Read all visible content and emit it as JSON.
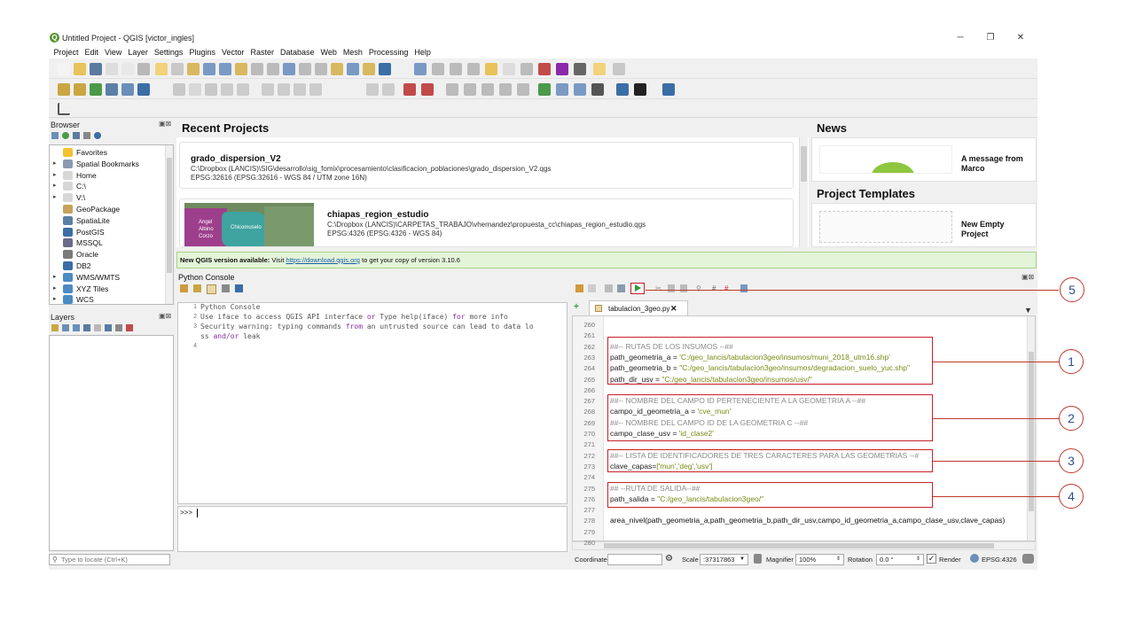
{
  "window": {
    "title": "Untitled Project - QGIS [victor_ingles]",
    "logo_letter": "Q",
    "minimize": "─",
    "restore": "❐",
    "close": "✕"
  },
  "menu": [
    "Project",
    "Edit",
    "View",
    "Layer",
    "Settings",
    "Plugins",
    "Vector",
    "Raster",
    "Database",
    "Web",
    "Mesh",
    "Processing",
    "Help"
  ],
  "browser": {
    "title": "Browser",
    "items": [
      {
        "label": "Favorites",
        "icon": "star-icon",
        "color": "#f2c230"
      },
      {
        "label": "Spatial Bookmarks",
        "icon": "bookmark-icon",
        "color": "#8a9bb0"
      },
      {
        "label": "Home",
        "icon": "home-folder-icon",
        "color": "#d7d7d7"
      },
      {
        "label": "C:\\",
        "icon": "drive-icon",
        "color": "#d7d7d7"
      },
      {
        "label": "V:\\",
        "icon": "drive-icon",
        "color": "#d7d7d7"
      },
      {
        "label": "GeoPackage",
        "icon": "geopackage-icon",
        "color": "#c6a35a"
      },
      {
        "label": "SpatiaLite",
        "icon": "spatialite-icon",
        "color": "#5c7fa6"
      },
      {
        "label": "PostGIS",
        "icon": "postgis-icon",
        "color": "#3a6ea5"
      },
      {
        "label": "MSSQL",
        "icon": "mssql-icon",
        "color": "#6a6a8a"
      },
      {
        "label": "Oracle",
        "icon": "oracle-icon",
        "color": "#7a7a7a"
      },
      {
        "label": "DB2",
        "icon": "db2-icon",
        "color": "#3a6ea5"
      },
      {
        "label": "WMS/WMTS",
        "icon": "globe-icon",
        "color": "#4a8bc4"
      },
      {
        "label": "XYZ Tiles",
        "icon": "globe-icon",
        "color": "#4a8bc4"
      },
      {
        "label": "WCS",
        "icon": "globe-icon",
        "color": "#4a8bc4"
      }
    ]
  },
  "layers": {
    "title": "Layers"
  },
  "locate": {
    "placeholder": "Type to locate (Ctrl+K)"
  },
  "recent": {
    "title": "Recent Projects",
    "projects": [
      {
        "name": "grado_dispersion_V2",
        "path": "C:\\Dropbox (LANCIS)\\SIG\\desarrollo\\sig_fomix\\procesamiento\\clasificacion_poblaciones\\grado_dispersion_V2.qgs",
        "crs": "EPSG:32616 (EPSG:32616 - WGS 84 / UTM zone 16N)"
      },
      {
        "name": "chiapas_region_estudio",
        "path": "C:\\Dropbox (LANCIS)\\CARPETAS_TRABAJO\\vhernandez\\propuesta_cc\\chiapas_region_estudio.qgs",
        "crs": "EPSG:4326 (EPSG:4326 - WGS 84)",
        "thumb_labels": [
          "Angel Albino Corzo",
          "Chicomuselo"
        ]
      }
    ]
  },
  "news": {
    "title": "News",
    "message_title": "A message from Marco"
  },
  "templates": {
    "title": "Project Templates",
    "item": "New Empty Project"
  },
  "banner": {
    "prefix": "New QGIS version available:",
    "visit": "Visit",
    "link": "https://download.qgis.org",
    "suffix": "to get your copy of version 3.10.6"
  },
  "python_console": {
    "title": "Python Console",
    "lines": [
      {
        "num": "1",
        "text": "Python Console"
      },
      {
        "num": "2",
        "text": "Use iface to access QGIS API interface or Type help(iface) for more info"
      },
      {
        "num": "3",
        "text": "Security warning: typing commands from an untrusted source can lead to data lo"
      },
      {
        "num": "",
        "text": "ss and/or leak"
      },
      {
        "num": "4",
        "text": ""
      }
    ],
    "prompt": ">>>"
  },
  "editor": {
    "tab": "tabulacion_3geo.py",
    "tab_close": "✕",
    "lines": [
      {
        "num": "260",
        "text": ""
      },
      {
        "num": "261",
        "text": ""
      },
      {
        "num": "262",
        "text": "##-- RUTAS DE LOS INSUMOS --##"
      },
      {
        "num": "263",
        "text": "path_geometria_a = 'C:/geo_lancis/tabulacion3geo/insumos/muni_2018_utm16.shp'"
      },
      {
        "num": "264",
        "text": "path_geometria_b = \"C:/geo_lancis/tabulacion3geo/insumos/degradacion_suelo_yuc.shp\""
      },
      {
        "num": "265",
        "text": "path_dir_usv = \"C:/geo_lancis/tabulacion3geo/insumos/usv/\""
      },
      {
        "num": "266",
        "text": ""
      },
      {
        "num": "267",
        "text": "##-- NOMBRE DEL CAMPO ID PERTENECIENTE A LA GEOMETRIA A --##"
      },
      {
        "num": "268",
        "text": "campo_id_geometria_a = 'cve_mun'"
      },
      {
        "num": "269",
        "text": "##-- NOMBRE DEL CAMPO ID DE LA GEOMETRIA C --##"
      },
      {
        "num": "270",
        "text": "campo_clase_usv = 'id_clase2'"
      },
      {
        "num": "271",
        "text": ""
      },
      {
        "num": "272",
        "text": "##-- LISTA DE IDENTIFICADORES DE TRES CARACTERES PARA LAS GEOMETRIAS --#"
      },
      {
        "num": "273",
        "text": "clave_capas=['mun','deg','usv']"
      },
      {
        "num": "274",
        "text": ""
      },
      {
        "num": "275",
        "text": "## --RUTA DE SALIDA--##"
      },
      {
        "num": "276",
        "text": "path_salida = \"C:/geo_lancis/tabulacion3geo/\""
      },
      {
        "num": "277",
        "text": ""
      },
      {
        "num": "278",
        "text": "area_nivel(path_geometria_a,path_geometria_b,path_dir_usv,campo_id_geometria_a,campo_clase_usv,clave_capas)"
      },
      {
        "num": "279",
        "text": ""
      },
      {
        "num": "280",
        "text": ""
      }
    ]
  },
  "callouts": [
    "1",
    "2",
    "3",
    "4",
    "5"
  ],
  "status": {
    "coordinate_label": "Coordinate",
    "scale_label": "Scale",
    "scale_value": ":37317863",
    "magnifier_label": "Magnifier",
    "magnifier_value": "100%",
    "rotation_label": "Rotation",
    "rotation_value": "0.0 °",
    "render_label": "Render",
    "crs": "EPSG:4326"
  },
  "colors": {
    "accent_red": "#c8202a",
    "callout_blue": "#2b4f8f",
    "banner_bg": "#e3f4d9",
    "qgis_green": "#589632"
  }
}
